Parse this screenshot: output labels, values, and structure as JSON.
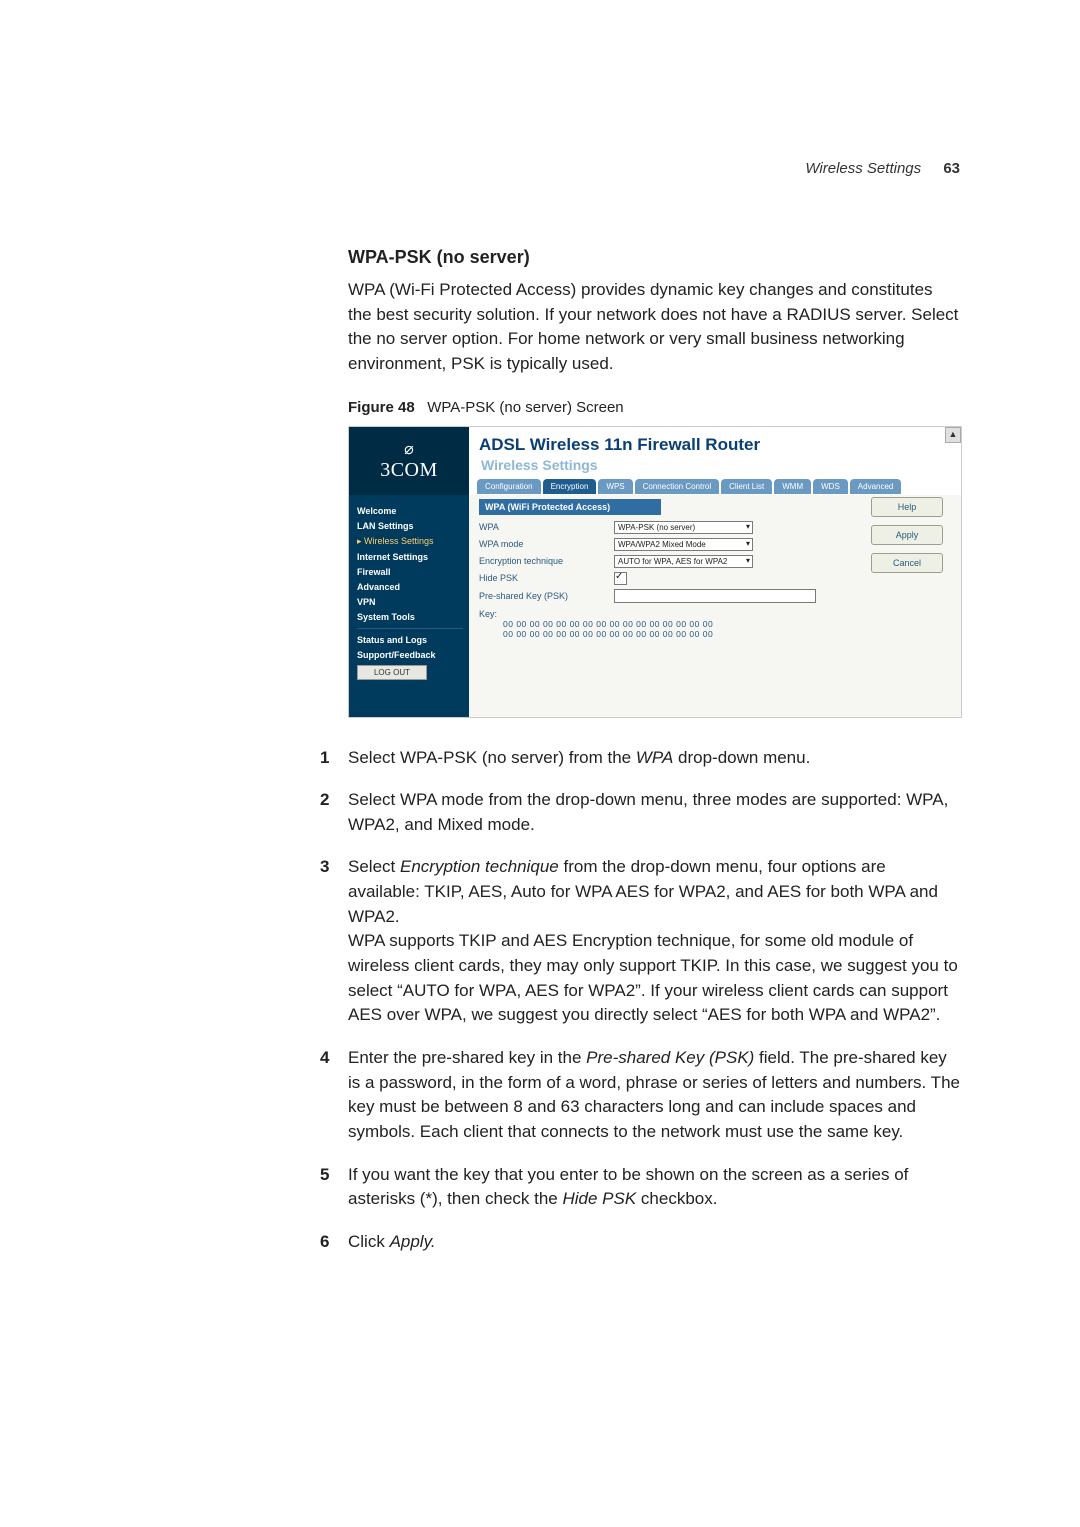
{
  "header": {
    "section": "Wireless Settings",
    "page": "63"
  },
  "title": "WPA-PSK (no server)",
  "intro": "WPA (Wi-Fi Protected Access) provides dynamic key changes and constitutes the best security solution. If your network does not have a RADIUS server. Select the no server option. For home network or very small business networking environment, PSK is typically used.",
  "figure": {
    "label": "Figure 48",
    "caption": "WPA-PSK (no server) Screen"
  },
  "screenshot": {
    "brand": "3COM",
    "product": "ADSL Wireless 11n Firewall Router",
    "subtitle": "Wireless Settings",
    "tabs": [
      "Configuration",
      "Encryption",
      "WPS",
      "Connection Control",
      "Client List",
      "WMM",
      "WDS",
      "Advanced"
    ],
    "activeTabIndex": 1,
    "nav": [
      "Welcome",
      "LAN Settings",
      "Wireless Settings",
      "Internet Settings",
      "Firewall",
      "Advanced",
      "VPN",
      "System Tools",
      "Status and Logs",
      "Support/Feedback"
    ],
    "navCurrentIndex": 2,
    "logout": "LOG OUT",
    "sectionTitle": "WPA (WiFi Protected Access)",
    "fields": {
      "wpa_label": "WPA",
      "wpa_value": "WPA-PSK (no server)",
      "mode_label": "WPA mode",
      "mode_value": "WPA/WPA2 Mixed Mode",
      "enc_label": "Encryption technique",
      "enc_value": "AUTO for WPA, AES for WPA2",
      "hide_label": "Hide PSK",
      "psk_label": "Pre-shared Key (PSK)",
      "key_label": "Key:",
      "key_hex1": "00 00 00 00 00 00 00 00 00 00 00 00 00 00 00 00",
      "key_hex2": "00 00 00 00 00 00 00 00 00 00 00 00 00 00 00 00"
    },
    "buttons": [
      "Help",
      "Apply",
      "Cancel"
    ]
  },
  "steps": {
    "s1a": "Select WPA-PSK (no server) from the ",
    "s1i": "WPA",
    "s1b": " drop-down menu.",
    "s2": "Select WPA mode from the drop-down menu, three modes are supported: WPA, WPA2, and Mixed mode.",
    "s3a": "Select ",
    "s3i": "Encryption technique",
    "s3b": " from the drop-down menu, four options are available: TKIP, AES, Auto for WPA AES for WPA2, and AES for both WPA and WPA2.",
    "s3c": "WPA supports TKIP and AES Encryption technique, for some old module of wireless client cards, they may only support TKIP. In this case, we suggest you to select “AUTO for WPA, AES for WPA2”. If your wireless client cards can support AES over WPA, we suggest you directly select “AES for both WPA and WPA2”.",
    "s4a": "Enter the pre-shared key in the ",
    "s4i": "Pre-shared Key (PSK)",
    "s4b": " field. The pre-shared key is a password, in the form of a word, phrase or series of letters and numbers. The key must be between 8 and 63 characters long and can include spaces and symbols. Each client that connects to the network must use the same key.",
    "s5a": "If you want the key that you enter to be shown on the screen as a series of asterisks (*), then check the ",
    "s5i": "Hide PSK",
    "s5b": " checkbox.",
    "s6a": "Click ",
    "s6i": "Apply."
  }
}
